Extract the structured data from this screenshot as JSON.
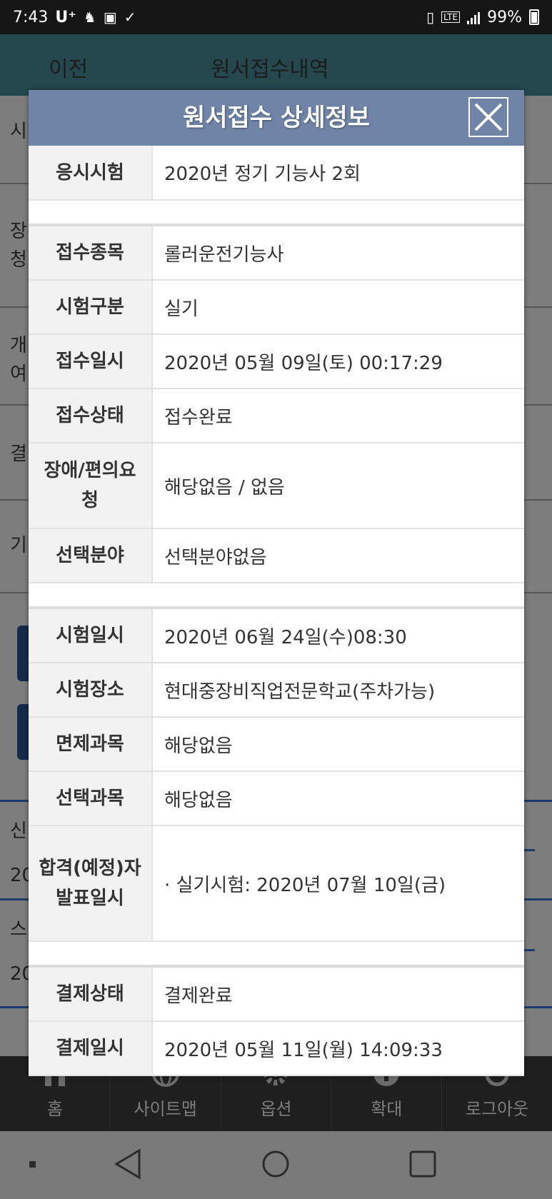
{
  "status_bar": {
    "time": "7:43",
    "carrier": "U⁺",
    "battery": "99%",
    "net": "LTE"
  },
  "app": {
    "back_label": "이전",
    "title": "원서접수내역",
    "bg_labels": [
      "시",
      "장\n청",
      "개\n여",
      "결",
      "기",
      "신",
      "20",
      "스",
      "20"
    ]
  },
  "modal": {
    "title": "원서접수 상세정보",
    "groups": [
      [
        {
          "label": "응시시험",
          "value": "2020년 정기 기능사 2회"
        }
      ],
      [
        {
          "label": "접수종목",
          "value": "롤러운전기능사"
        },
        {
          "label": "시험구분",
          "value": "실기"
        },
        {
          "label": "접수일시",
          "value": "2020년 05월 09일(토) 00:17:29"
        },
        {
          "label": "접수상태",
          "value": "접수완료"
        },
        {
          "label": "장애/편의요청",
          "value": "해당없음 / 없음"
        },
        {
          "label": "선택분야",
          "value": "선택분야없음"
        }
      ],
      [
        {
          "label": "시험일시",
          "value": "2020년 06월 24일(수)08:30"
        },
        {
          "label": "시험장소",
          "value": "현대중장비직업전문학교(주차가능)"
        },
        {
          "label": "면제과목",
          "value": "해당없음"
        },
        {
          "label": "선택과목",
          "value": "해당없음"
        },
        {
          "label": "합격(예정)자 발표일시",
          "value": "· 실기시험: 2020년 07월 10일(금)"
        }
      ],
      [
        {
          "label": "결제상태",
          "value": "결제완료"
        },
        {
          "label": "결제일시",
          "value": "2020년 05월 11일(월) 14:09:33"
        }
      ]
    ]
  },
  "bottom_nav": [
    {
      "label": "홈",
      "icon": "home-icon"
    },
    {
      "label": "사이트맵",
      "icon": "globe-icon"
    },
    {
      "label": "옵션",
      "icon": "gear-icon"
    },
    {
      "label": "확대",
      "icon": "zoom-plus-icon"
    },
    {
      "label": "로그아웃",
      "icon": "power-icon"
    }
  ],
  "colors": {
    "modal_header": "#6f84a7",
    "label_bg": "#f2f2f2",
    "appbar": "#24484e"
  }
}
